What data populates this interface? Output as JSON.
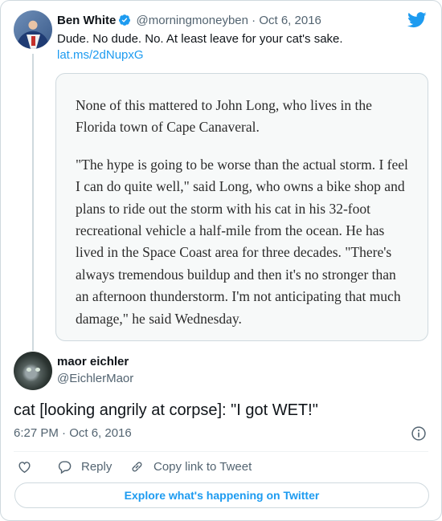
{
  "parent_tweet": {
    "author_name": "Ben White",
    "handle": "@morningmoneyben",
    "separator": "·",
    "date": "Oct 6, 2016",
    "text": "Dude. No dude. No. At least leave for your cat's sake.",
    "link": "lat.ms/2dNupxG",
    "quote_paragraphs": [
      "None of this mattered to John Long, who lives in the Florida town of Cape Canaveral.",
      "\"The hype is going to be worse than the actual storm. I feel I can do quite well,\" said Long, who owns a bike shop and plans to ride out the storm with his cat in his 32-foot recreational vehicle a half-mile from the ocean. He has lived in the Space Coast area for three decades. \"There's always tremendous buildup and then it's no stronger than an afternoon thunderstorm. I'm not anticipating that much damage,\" he said Wednesday."
    ]
  },
  "main_tweet": {
    "author_name": "maor eichler",
    "handle": "@EichlerMaor",
    "text": "cat [looking angrily at corpse]: \"I got WET!\"",
    "timestamp": "6:27 PM · Oct 6, 2016"
  },
  "actions": {
    "reply_label": "Reply",
    "copy_link_label": "Copy link to Tweet"
  },
  "explore_label": "Explore what's happening on Twitter",
  "colors": {
    "accent": "#1d9bf0",
    "text": "#0f1419",
    "muted": "#536471",
    "border": "#cfd9de"
  },
  "icons": [
    "twitter-bird-icon",
    "verified-badge-icon",
    "info-icon",
    "heart-icon",
    "reply-icon",
    "link-icon"
  ]
}
